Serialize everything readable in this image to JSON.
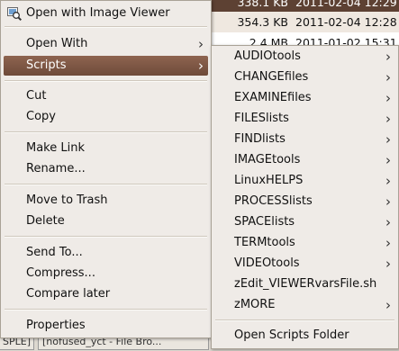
{
  "background": {
    "rows": [
      {
        "size": "338.1 KB",
        "date": "2011-02-04 12:29"
      },
      {
        "size": "354.3 KB",
        "date": "2011-02-04 12:28"
      },
      {
        "size": "2.4 MB",
        "date": "2011-01-02 15:31"
      }
    ],
    "tabs": [
      "SPLE]",
      "[nofused_yct - File Bro..."
    ]
  },
  "context_menu": {
    "items": [
      {
        "label": "Open with Image Viewer",
        "icon": "image-viewer-icon"
      },
      {
        "label": "Open With"
      },
      {
        "label": "Scripts"
      },
      {
        "label": "Cut"
      },
      {
        "label": "Copy"
      },
      {
        "label": "Make Link"
      },
      {
        "label": "Rename..."
      },
      {
        "label": "Move to Trash"
      },
      {
        "label": "Delete"
      },
      {
        "label": "Send To..."
      },
      {
        "label": "Compress..."
      },
      {
        "label": "Compare later"
      },
      {
        "label": "Properties"
      }
    ]
  },
  "scripts_submenu": {
    "items": [
      {
        "label": "AUDIOtools"
      },
      {
        "label": "CHANGEfiles"
      },
      {
        "label": "EXAMINEfiles"
      },
      {
        "label": "FILESlists"
      },
      {
        "label": "FINDlists"
      },
      {
        "label": "IMAGEtools"
      },
      {
        "label": "LinuxHELPS"
      },
      {
        "label": "PROCESSlists"
      },
      {
        "label": "SPACElists"
      },
      {
        "label": "TERMtools"
      },
      {
        "label": "VIDEOtools"
      },
      {
        "label": "zEdit_VIEWERvarsFile.sh"
      },
      {
        "label": "zMORE"
      },
      {
        "label": "Open Scripts Folder"
      }
    ]
  },
  "colors": {
    "highlight": "#7a5240",
    "menu_bg": "#efebe7"
  }
}
